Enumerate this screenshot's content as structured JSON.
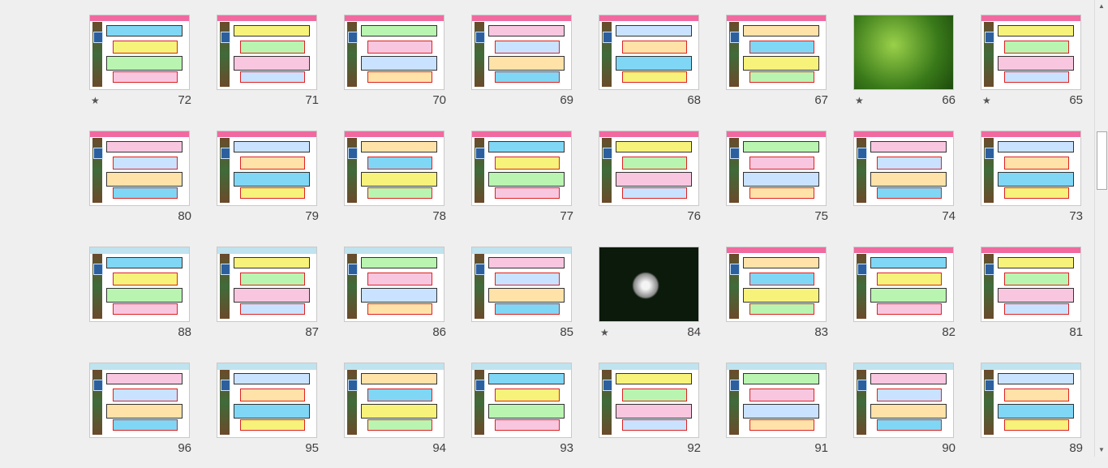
{
  "rows": [
    {
      "slides": [
        {
          "number": "72",
          "starred": true,
          "kind": "text-pink"
        },
        {
          "number": "71",
          "starred": false,
          "kind": "text-pink"
        },
        {
          "number": "70",
          "starred": false,
          "kind": "text-pink"
        },
        {
          "number": "69",
          "starred": false,
          "kind": "text-pink"
        },
        {
          "number": "68",
          "starred": false,
          "kind": "text-pink"
        },
        {
          "number": "67",
          "starred": false,
          "kind": "text-pink"
        },
        {
          "number": "66",
          "starred": true,
          "kind": "photo-leaf"
        },
        {
          "number": "65",
          "starred": true,
          "kind": "text-plain"
        }
      ]
    },
    {
      "slides": [
        {
          "number": "80",
          "starred": false,
          "kind": "text-pink"
        },
        {
          "number": "79",
          "starred": false,
          "kind": "text-pink"
        },
        {
          "number": "78",
          "starred": false,
          "kind": "text-pink"
        },
        {
          "number": "77",
          "starred": false,
          "kind": "text-pink"
        },
        {
          "number": "76",
          "starred": false,
          "kind": "text-pink"
        },
        {
          "number": "75",
          "starred": false,
          "kind": "text-pink"
        },
        {
          "number": "74",
          "starred": false,
          "kind": "text-pink"
        },
        {
          "number": "73",
          "starred": false,
          "kind": "text-pink"
        }
      ]
    },
    {
      "slides": [
        {
          "number": "88",
          "starred": false,
          "kind": "text-blue"
        },
        {
          "number": "87",
          "starred": false,
          "kind": "text-blue"
        },
        {
          "number": "86",
          "starred": false,
          "kind": "text-blue"
        },
        {
          "number": "85",
          "starred": false,
          "kind": "text-blue"
        },
        {
          "number": "84",
          "starred": true,
          "kind": "photo-dark"
        },
        {
          "number": "83",
          "starred": false,
          "kind": "text-pink"
        },
        {
          "number": "82",
          "starred": false,
          "kind": "text-pink"
        },
        {
          "number": "81",
          "starred": false,
          "kind": "text-pink"
        }
      ]
    },
    {
      "slides": [
        {
          "number": "96",
          "starred": false,
          "kind": "text-blue"
        },
        {
          "number": "95",
          "starred": false,
          "kind": "text-blue"
        },
        {
          "number": "94",
          "starred": false,
          "kind": "text-blue"
        },
        {
          "number": "93",
          "starred": false,
          "kind": "text-blue"
        },
        {
          "number": "92",
          "starred": false,
          "kind": "text-blue"
        },
        {
          "number": "91",
          "starred": false,
          "kind": "text-blue"
        },
        {
          "number": "90",
          "starred": false,
          "kind": "text-blue"
        },
        {
          "number": "89",
          "starred": false,
          "kind": "text-blue"
        }
      ]
    }
  ],
  "star_glyph": "★",
  "scroll": {
    "up_icon": "triangle-up",
    "down_icon": "triangle-down"
  }
}
